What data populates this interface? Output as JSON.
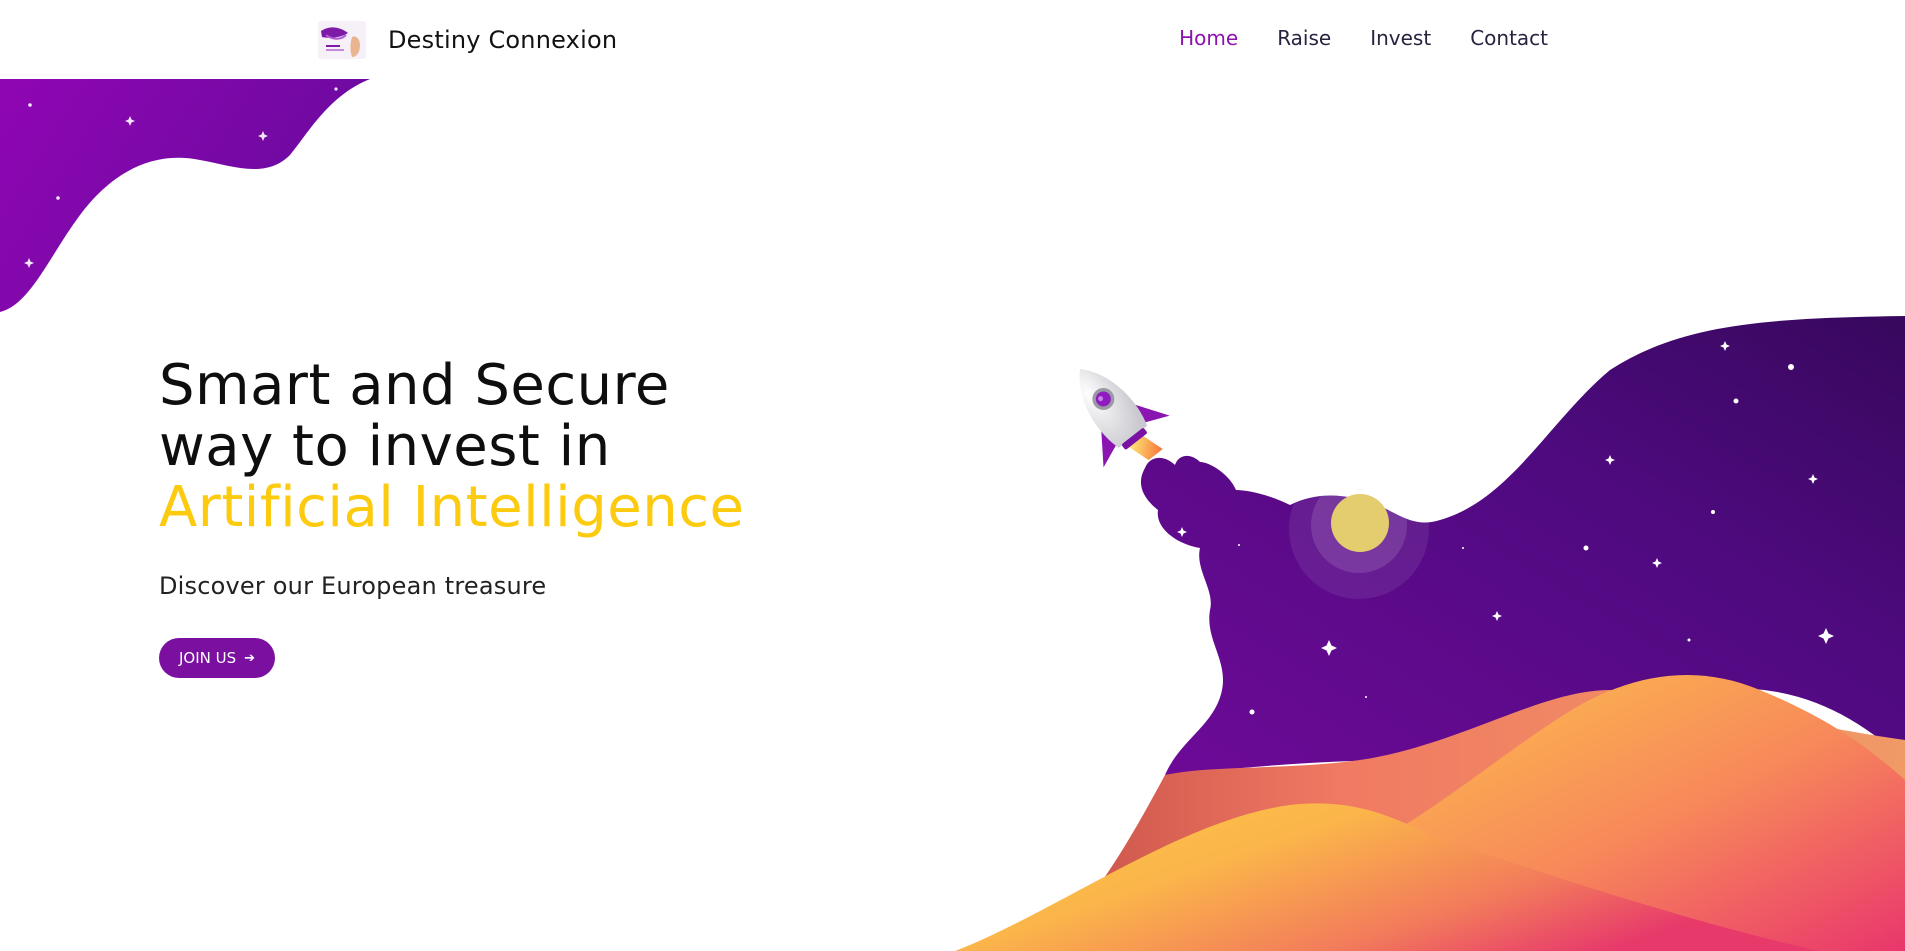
{
  "header": {
    "brand_name": "Destiny Connexion",
    "logo_icon": "destiny-connexion-logo",
    "nav": [
      {
        "label": "Home",
        "active": true
      },
      {
        "label": "Raise",
        "active": false
      },
      {
        "label": "Invest",
        "active": false
      },
      {
        "label": "Contact",
        "active": false
      }
    ]
  },
  "hero": {
    "title_line1": "Smart and Secure",
    "title_line2": "way to invest in",
    "title_accent": "Artificial Intelligence",
    "subtitle": "Discover our European treasure",
    "cta_label": "JOIN US",
    "cta_icon": "arrow-right-icon"
  },
  "colors": {
    "accent_purple": "#8c12b0",
    "highlight_yellow": "#fccb10",
    "button_purple": "#7b0fa0",
    "space_dark": "#3c0a63",
    "dune_orange": "#f7884f",
    "dune_pink": "#ea3a6c"
  },
  "illustration": {
    "name": "rocket-launch-space-illustration"
  }
}
